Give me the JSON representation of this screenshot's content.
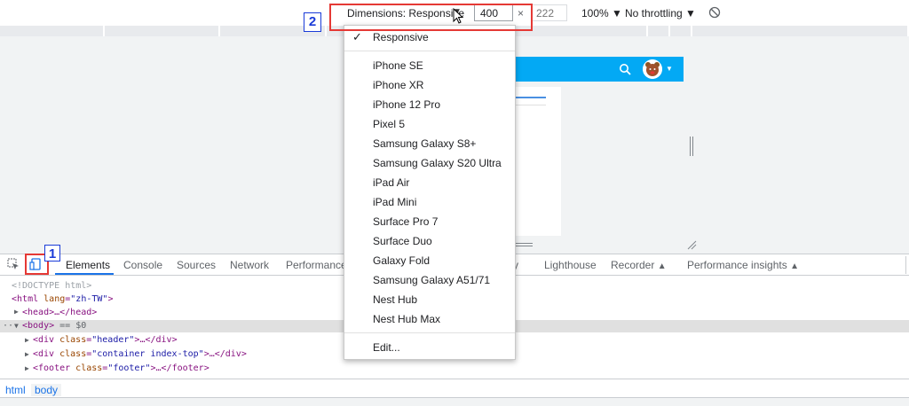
{
  "device_toolbar": {
    "dimensions_label": "Dimensions: Responsive",
    "width_value": "400",
    "height_placeholder": "222",
    "zoom": "100%",
    "throttling": "No throttling",
    "icons": [
      "rotate-icon"
    ]
  },
  "annotations": {
    "one": "1",
    "two": "2",
    "highlight_color": "#e53935",
    "label_color": "#1a3bd8"
  },
  "page_preview": {
    "header_color": "#03a9f4",
    "icons": [
      "search-icon",
      "avatar",
      "chevron-down-icon"
    ]
  },
  "dropdown": {
    "checked_item": "Responsive",
    "devices": [
      "iPhone SE",
      "iPhone XR",
      "iPhone 12 Pro",
      "Pixel 5",
      "Samsung Galaxy S8+",
      "Samsung Galaxy S20 Ultra",
      "iPad Air",
      "iPad Mini",
      "Surface Pro 7",
      "Surface Duo",
      "Galaxy Fold",
      "Samsung Galaxy A51/71",
      "Nest Hub",
      "Nest Hub Max"
    ],
    "edit": "Edit..."
  },
  "devtools": {
    "tabs": [
      "Elements",
      "Console",
      "Sources",
      "Network",
      "Performance",
      "Lighthouse",
      "Recorder",
      "Performance insights"
    ],
    "active_tab": "Elements",
    "accent_color": "#1a73e8"
  },
  "elements_tree": {
    "doctype": "<!DOCTYPE html>",
    "html_tag": "html",
    "html_lang_attr": "lang",
    "html_lang_value": "\"zh-TW\"",
    "head": "<head>…</head>",
    "body_tag": "<body>",
    "body_ref": " == $0",
    "div1_attr": "class",
    "div1_value": "\"header\"",
    "div2_value": "\"container index-top\"",
    "footer_value": "\"footer\""
  },
  "breadcrumbs": [
    "html",
    "body"
  ]
}
